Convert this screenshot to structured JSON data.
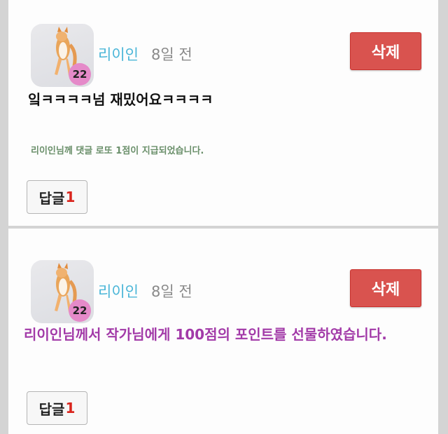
{
  "comments": [
    {
      "avatar_level": "22",
      "author": "리이인",
      "time": "8일 전",
      "delete_label": "삭제",
      "text": "잌ㅋㅋㅋㅋ넘 재밌어요ㅋㅋㅋㅋ",
      "lotto_notice": "리이인님께 댓글 로또 1점이 지급되었습니다.",
      "reply_label": "답글",
      "reply_count": "1"
    },
    {
      "avatar_level": "22",
      "author": "리이인",
      "time": "8일 전",
      "delete_label": "삭제",
      "gift_text": "리이인님께서 작가님에게 100점의 포인트를 선물하였습니다.",
      "reply_label": "답글",
      "reply_count": "1"
    }
  ],
  "colors": {
    "author": "#4bb6d8",
    "delete_button": "#d9534f",
    "gift_text": "#a23aa8",
    "reply_count": "#d9251d",
    "level_badge": "#e58ac9"
  }
}
